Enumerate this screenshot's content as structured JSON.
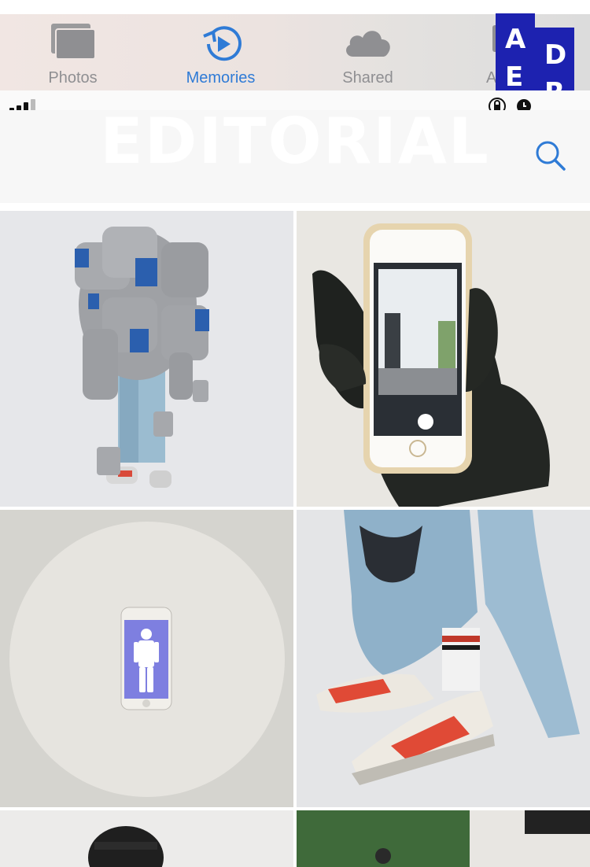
{
  "tabs": [
    {
      "label": "Photos",
      "icon": "photos-stack-icon",
      "active": false
    },
    {
      "label": "Memories",
      "icon": "memories-play-icon",
      "active": true
    },
    {
      "label": "Shared",
      "icon": "cloud-icon",
      "active": false
    },
    {
      "label": "A",
      "icon": "album-icon",
      "active": false
    }
  ],
  "logo": {
    "letters": [
      "A",
      "E",
      "D",
      "R"
    ],
    "color": "#1d22b0"
  },
  "header": {
    "title": "EDITORIAL",
    "search_icon": "search-icon"
  },
  "colors": {
    "accent": "#2f7bd6",
    "inactive": "#8f8f92",
    "logo": "#1d22b0"
  },
  "grid": [
    {
      "id": "backpack-model"
    },
    {
      "id": "gloved-hand-phone"
    },
    {
      "id": "phone-on-disc"
    },
    {
      "id": "sneakers-jeans"
    },
    {
      "id": "cap-portrait"
    },
    {
      "id": "gallery-scene"
    }
  ]
}
